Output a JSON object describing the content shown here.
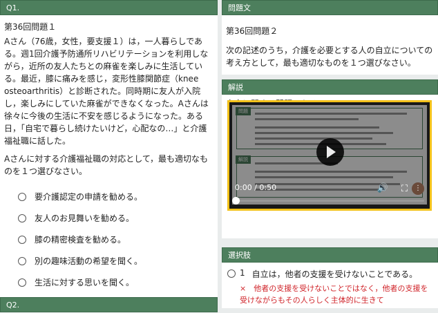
{
  "left": {
    "q1_header": "Q1.",
    "q1_number": "第36回問題１",
    "q1_story": "Aさん（76歳，女性，要支援１）は，一人暮らしである。週1回介護予防通所リハビリテーションを利用しながら，近所の友人たちとの麻雀を楽しみに生活している。最近，膝に痛みを感じ，変形性膝関節症（knee osteoarthritis）と診断された。同時期に友人が入院し，楽しみにしていた麻雀ができなくなった。Aさんは徐々に今後の生活に不安を感じるようになった。ある日，「自宅で暮らし続けたいけど，心配なの…」と介護福祉職に話した。",
    "q1_prompt": "Aさんに対する介護福祉職の対応として，最も適切なものを１つ選びなさい。",
    "options": [
      "要介護認定の申請を勧める。",
      "友人のお見舞いを勧める。",
      "膝の精密検査を勧める。",
      "別の趣味活動の希望を聞く。",
      "生活に対する思いを聞く。"
    ],
    "q2_header": "Q2."
  },
  "right": {
    "mondai_header": "問題文",
    "mondai_number": "第36回問題２",
    "mondai_text": "次の記述のうち，介護を必要とする人の自立についての考え方として，最も適切なものを１つ選びなさい。",
    "kaisetsu_header": "解説",
    "kaisetsu_text": "自立に関する問題である。",
    "video": {
      "slide_tag1": "問題",
      "slide_tag2": "解説",
      "time": "0:00 / 0:50",
      "progress": 0
    },
    "sentakushi_header": "選択肢",
    "choice1_num": "1",
    "choice1_text": "自立は，他者の支援を受けないことである。",
    "choice1_note": "×　他者の支援を受けないことではなく，他者の支援を受けながらもその人らしく主体的に生きて"
  }
}
